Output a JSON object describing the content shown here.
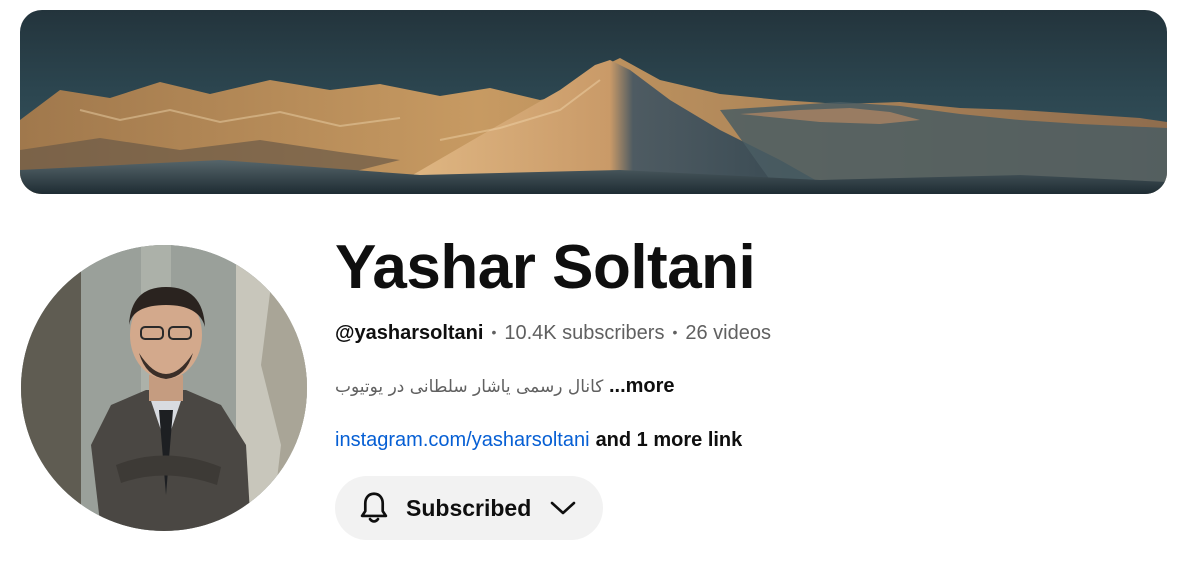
{
  "channel": {
    "name": "Yashar Soltani",
    "handle": "@yasharsoltani",
    "subscribers": "10.4K subscribers",
    "videos": "26 videos",
    "separator": "•",
    "description": "کانال رسمی یاشار سلطانی در یوتیوب",
    "description_more": "...more",
    "link_text": "instagram.com/yasharsoltani",
    "more_links": "and 1 more link"
  },
  "subscribe_button": {
    "label": "Subscribed",
    "icon": "bell-icon",
    "dropdown_icon": "chevron-down-icon"
  },
  "colors": {
    "link": "#065fd4",
    "secondary_text": "#606060",
    "button_bg": "#f2f2f2"
  }
}
